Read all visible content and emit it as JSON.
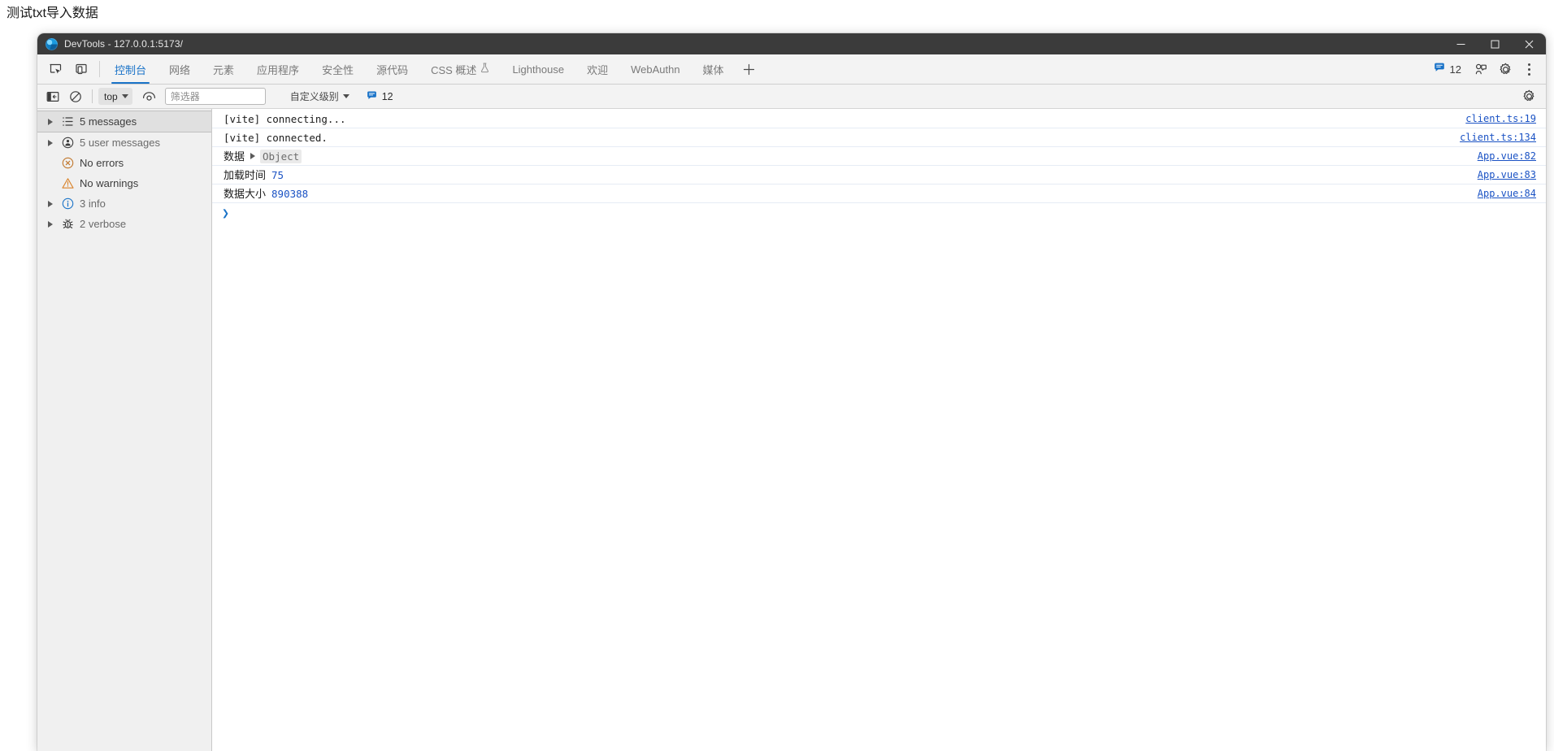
{
  "page": {
    "heading": "测试txt导入数据"
  },
  "window": {
    "title": "DevTools - 127.0.0.1:5173/",
    "app_icon": "devtools-logo-icon",
    "controls": {
      "minimize": "minimize-icon",
      "maximize": "maximize-icon",
      "close": "close-icon"
    }
  },
  "tabstrip": {
    "tools": [
      {
        "name": "inspect-element-icon",
        "title": "检查元素"
      },
      {
        "name": "device-toolbar-icon",
        "title": "切换设备工具栏"
      }
    ],
    "tabs": [
      {
        "label": "控制台",
        "active": true,
        "flask": false
      },
      {
        "label": "网络",
        "active": false,
        "flask": false
      },
      {
        "label": "元素",
        "active": false,
        "flask": false
      },
      {
        "label": "应用程序",
        "active": false,
        "flask": false
      },
      {
        "label": "安全性",
        "active": false,
        "flask": false
      },
      {
        "label": "源代码",
        "active": false,
        "flask": false
      },
      {
        "label": "CSS 概述",
        "active": false,
        "flask": true
      },
      {
        "label": "Lighthouse",
        "active": false,
        "flask": false
      },
      {
        "label": "欢迎",
        "active": false,
        "flask": false
      },
      {
        "label": "WebAuthn",
        "active": false,
        "flask": false
      },
      {
        "label": "媒体",
        "active": false,
        "flask": false
      }
    ],
    "add_tab": "+",
    "message_count": "12",
    "message_badge_icon": "speech-bubble-icon",
    "customize_icon": "devtools-customize-icon",
    "settings_icon": "gear-icon",
    "more_icon": "kebab-menu-icon"
  },
  "console_toolbar": {
    "sidebar_toggle_icon": "console-sidebar-toggle-icon",
    "clear_icon": "clear-console-icon",
    "context": "top",
    "live_expression_icon": "eye-icon",
    "filter_placeholder": "筛选器",
    "filter_value": "",
    "level": "自定义级别",
    "message_count": "12",
    "message_badge_icon": "speech-bubble-icon",
    "settings_icon": "gear-icon"
  },
  "sidebar": {
    "items": [
      {
        "label": "5 messages",
        "icon": "list-icon",
        "expandable": true,
        "selected": true,
        "muted": false
      },
      {
        "label": "5 user messages",
        "icon": "user-circle-icon",
        "expandable": true,
        "selected": false,
        "muted": true
      },
      {
        "label": "No errors",
        "icon": "error-circle-icon",
        "expandable": false,
        "selected": false,
        "muted": false
      },
      {
        "label": "No warnings",
        "icon": "warning-triangle-icon",
        "expandable": false,
        "selected": false,
        "muted": false
      },
      {
        "label": "3 info",
        "icon": "info-circle-icon",
        "expandable": true,
        "selected": false,
        "muted": true
      },
      {
        "label": "2 verbose",
        "icon": "bug-icon",
        "expandable": true,
        "selected": false,
        "muted": true
      }
    ]
  },
  "console": {
    "rows": [
      {
        "kind": "plain",
        "text": "[vite] connecting...",
        "source": "client.ts:19"
      },
      {
        "kind": "plain",
        "text": "[vite] connected.",
        "source": "client.ts:134"
      },
      {
        "kind": "object",
        "label": "数据",
        "object_name": "Object",
        "source": "App.vue:82"
      },
      {
        "kind": "value",
        "label": "加载时间",
        "value": "75",
        "source": "App.vue:83"
      },
      {
        "kind": "value",
        "label": "数据大小",
        "value": "890388",
        "source": "App.vue:84"
      }
    ],
    "prompt_caret": "❯",
    "prompt_value": ""
  },
  "colors": {
    "accent": "#1a73c8",
    "link": "#1a52c4",
    "titlebar": "#3b3b3b",
    "toolbar": "#f3f3f3",
    "sidebar": "#f0f0f0",
    "error": "#c0762a",
    "warning": "#d9832a",
    "info": "#1a73c8"
  }
}
